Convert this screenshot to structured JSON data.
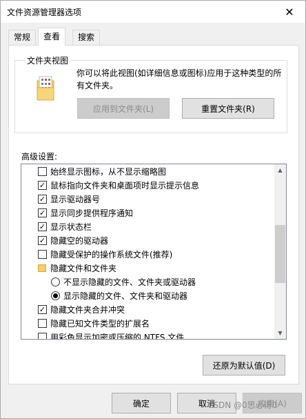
{
  "window": {
    "title": "文件资源管理器选项",
    "close_icon": "close-icon"
  },
  "tabs": [
    {
      "label": "常规",
      "active": false
    },
    {
      "label": "查看",
      "active": true
    },
    {
      "label": "搜索",
      "active": false
    }
  ],
  "folder_views": {
    "legend": "文件夹视图",
    "description": "你可以将此视图(如详细信息或图标)应用于这种类型的所有文件夹。",
    "apply_button": "应用到文件夹(L)",
    "reset_button": "重置文件夹(R)"
  },
  "advanced": {
    "label": "高级设置:",
    "items": [
      {
        "type": "checkbox",
        "checked": false,
        "label": "始终显示图标，从不显示缩略图"
      },
      {
        "type": "checkbox",
        "checked": true,
        "label": "鼠标指向文件夹和桌面项时显示提示信息"
      },
      {
        "type": "checkbox",
        "checked": true,
        "label": "显示驱动器号"
      },
      {
        "type": "checkbox",
        "checked": true,
        "label": "显示同步提供程序通知"
      },
      {
        "type": "checkbox",
        "checked": true,
        "label": "显示状态栏"
      },
      {
        "type": "checkbox",
        "checked": true,
        "label": "隐藏空的驱动器"
      },
      {
        "type": "checkbox",
        "checked": false,
        "label": "隐藏受保护的操作系统文件(推荐)"
      },
      {
        "type": "folder",
        "label": "隐藏文件和文件夹"
      },
      {
        "type": "radio",
        "checked": false,
        "label": "不显示隐藏的文件、文件夹或驱动器"
      },
      {
        "type": "radio",
        "checked": true,
        "label": "显示隐藏的文件、文件夹和驱动器"
      },
      {
        "type": "checkbox",
        "checked": true,
        "label": "隐藏文件夹合并冲突"
      },
      {
        "type": "checkbox",
        "checked": false,
        "label": "隐藏已知文件类型的扩展名"
      },
      {
        "type": "checkbox",
        "checked": false,
        "label": "用彩色显示加密或压缩的 NTFS 文件"
      }
    ],
    "restore_button": "还原为默认值(D)"
  },
  "footer": {
    "ok_button": "确定",
    "cancel_button": "取消",
    "apply_button": "应用(A)",
    "watermark": "CSDN @0思必得0"
  },
  "colors": {
    "dialog_bg": "#f0f0f0",
    "panel_bg": "#ffffff",
    "button_bg": "#e1e1e1",
    "folder_yellow": "#f5cf6a"
  }
}
